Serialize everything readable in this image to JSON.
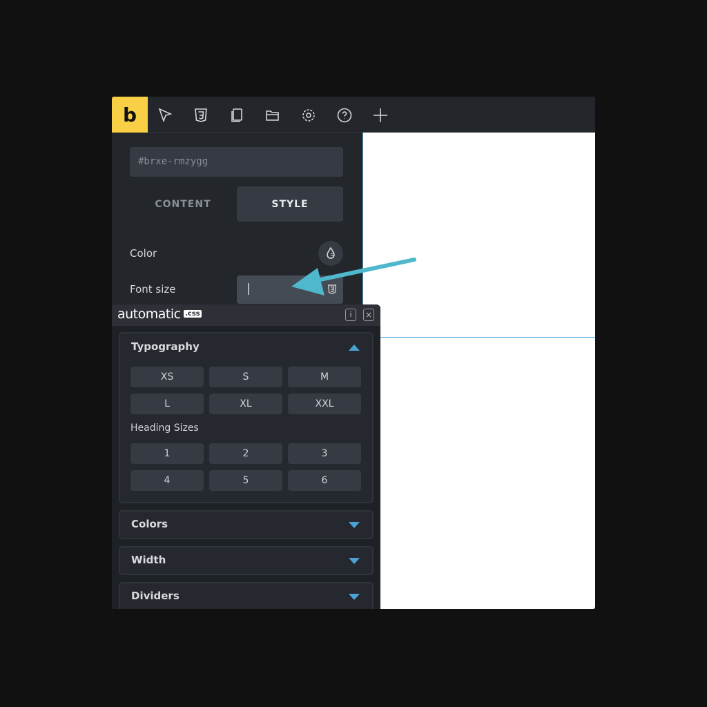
{
  "toolbar": {
    "logo": "b",
    "icons": [
      "cursor-icon",
      "css3-icon",
      "pages-icon",
      "folder-icon",
      "gear-icon",
      "help-icon",
      "plus-icon"
    ]
  },
  "panel": {
    "element_id": "#brxe-rmzygg",
    "tabs": [
      {
        "label": "CONTENT",
        "active": false
      },
      {
        "label": "STYLE",
        "active": true
      }
    ],
    "color_label": "Color",
    "font_size_label": "Font size",
    "font_size_value": "|"
  },
  "acss": {
    "logo_text": "automatic",
    "logo_badge": ".css",
    "typography": {
      "title": "Typography",
      "expanded": true,
      "sizes": [
        "XS",
        "S",
        "M",
        "L",
        "XL",
        "XXL"
      ],
      "heading_label": "Heading Sizes",
      "headings": [
        "1",
        "2",
        "3",
        "4",
        "5",
        "6"
      ]
    },
    "sections": [
      {
        "title": "Colors"
      },
      {
        "title": "Width"
      },
      {
        "title": "Dividers"
      }
    ]
  },
  "colors": {
    "accent": "#4fb8cc",
    "logo_bg": "#f9cf45",
    "selection": "#4aa3d4"
  }
}
